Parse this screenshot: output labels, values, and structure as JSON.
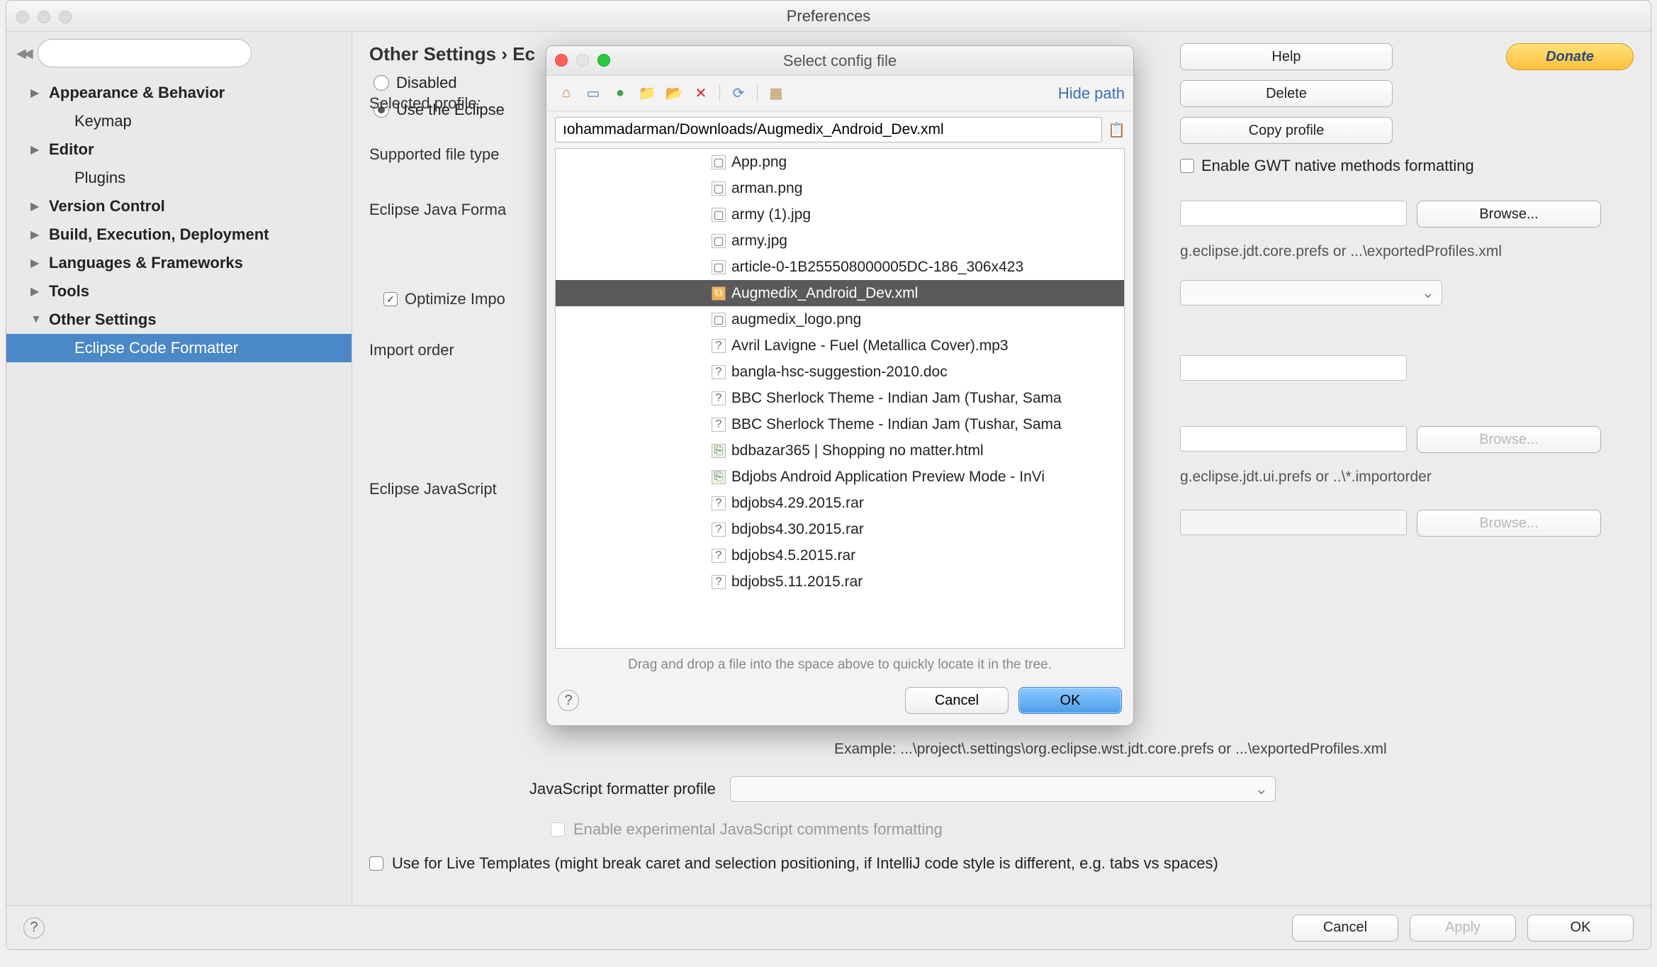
{
  "window": {
    "title": "Preferences"
  },
  "sidebar": {
    "search_placeholder": "",
    "items": [
      {
        "label": "Appearance & Behavior",
        "bold": true,
        "arrow": true
      },
      {
        "label": "Keymap",
        "bold": false,
        "arrow": false,
        "child": true
      },
      {
        "label": "Editor",
        "bold": true,
        "arrow": true
      },
      {
        "label": "Plugins",
        "bold": false,
        "arrow": false,
        "child": true
      },
      {
        "label": "Version Control",
        "bold": true,
        "arrow": true
      },
      {
        "label": "Build, Execution, Deployment",
        "bold": true,
        "arrow": true
      },
      {
        "label": "Languages & Frameworks",
        "bold": true,
        "arrow": true
      },
      {
        "label": "Tools",
        "bold": true,
        "arrow": true
      },
      {
        "label": "Other Settings",
        "bold": true,
        "arrow": true,
        "open": true
      },
      {
        "label": "Eclipse Code Formatter",
        "bold": false,
        "arrow": false,
        "child": true,
        "selected": true
      }
    ]
  },
  "main": {
    "breadcrumb": "Other Settings › Ec",
    "radio_disabled": "Disabled",
    "radio_use_eclipse": "Use the Eclipse",
    "selected_profile": "Selected profile:",
    "supported_types": "Supported file type",
    "eclipse_java": "Eclipse Java Forma",
    "optimize_imports": "Optimize Impo",
    "import_order": "Import order",
    "eclipse_js": "Eclipse JavaScript",
    "js_profile": "JavaScript formatter profile",
    "enable_js_comments": "Enable experimental JavaScript comments formatting",
    "live_templates": "Use for Live Templates (might break caret and selection positioning, if IntelliJ code style is different, e.g. tabs vs spaces)",
    "example1": "g.eclipse.jdt.core.prefs or ...\\exportedProfiles.xml",
    "example2": "g.eclipse.jdt.ui.prefs or ..\\*.importorder",
    "example3": "Example: ...\\project\\.settings\\org.eclipse.wst.jdt.core.prefs or ...\\exportedProfiles.xml",
    "help": "Help",
    "donate": "Donate",
    "delete": "Delete",
    "copy_profile": "Copy profile",
    "enable_gwt": "Enable GWT native methods formatting",
    "browse": "Browse..."
  },
  "footer": {
    "cancel": "Cancel",
    "apply": "Apply",
    "ok": "OK"
  },
  "dialog": {
    "title": "Select config file",
    "hide_path": "Hide path",
    "path": "ıohammadarman/Downloads/Augmedix_Android_Dev.xml",
    "hint": "Drag and drop a file into the space above to quickly locate it in the tree.",
    "cancel": "Cancel",
    "ok": "OK",
    "files": [
      {
        "name": "App.png",
        "icon": "img"
      },
      {
        "name": "arman.png",
        "icon": "img"
      },
      {
        "name": "army (1).jpg",
        "icon": "img"
      },
      {
        "name": "army.jpg",
        "icon": "img"
      },
      {
        "name": "article-0-1B255508000005DC-186_306x423",
        "icon": "img"
      },
      {
        "name": "Augmedix_Android_Dev.xml",
        "icon": "xml",
        "selected": true
      },
      {
        "name": "augmedix_logo.png",
        "icon": "img"
      },
      {
        "name": "Avril Lavigne - Fuel (Metallica Cover).mp3",
        "icon": "file"
      },
      {
        "name": "bangla-hsc-suggestion-2010.doc",
        "icon": "file"
      },
      {
        "name": "BBC Sherlock Theme - Indian Jam (Tushar, Sama",
        "icon": "file"
      },
      {
        "name": "BBC Sherlock Theme - Indian Jam (Tushar, Sama",
        "icon": "file"
      },
      {
        "name": "bdbazar365 | Shopping no matter.html",
        "icon": "html"
      },
      {
        "name": "Bdjobs Android Application Preview Mode - InVi",
        "icon": "html"
      },
      {
        "name": "bdjobs4.29.2015.rar",
        "icon": "file"
      },
      {
        "name": "bdjobs4.30.2015.rar",
        "icon": "file"
      },
      {
        "name": "bdjobs4.5.2015.rar",
        "icon": "file"
      },
      {
        "name": "bdjobs5.11.2015.rar",
        "icon": "file"
      }
    ]
  }
}
